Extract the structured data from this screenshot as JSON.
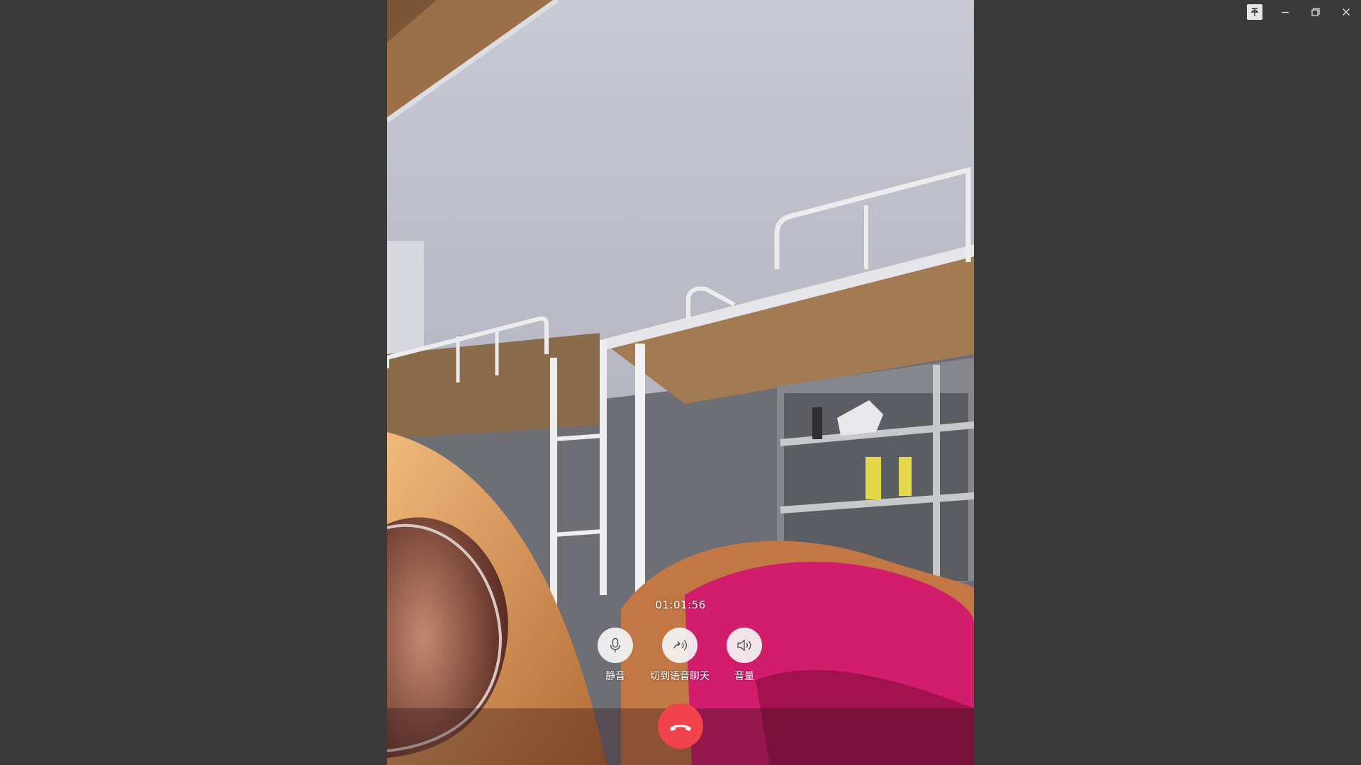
{
  "window": {
    "controls": {
      "pin_icon": "pin-icon",
      "minimize_icon": "minimize-icon",
      "restore_icon": "restore-icon",
      "close_icon": "close-icon"
    }
  },
  "call": {
    "duration": "01:01:56",
    "buttons": {
      "mute_label": "静音",
      "switch_voice_label": "切到语音聊天",
      "volume_label": "音量"
    },
    "hangup_color": "#f0434c"
  },
  "colors": {
    "background": "#3a3a3a",
    "control_circle": "#f5f5f5",
    "hangup": "#f0434c"
  }
}
